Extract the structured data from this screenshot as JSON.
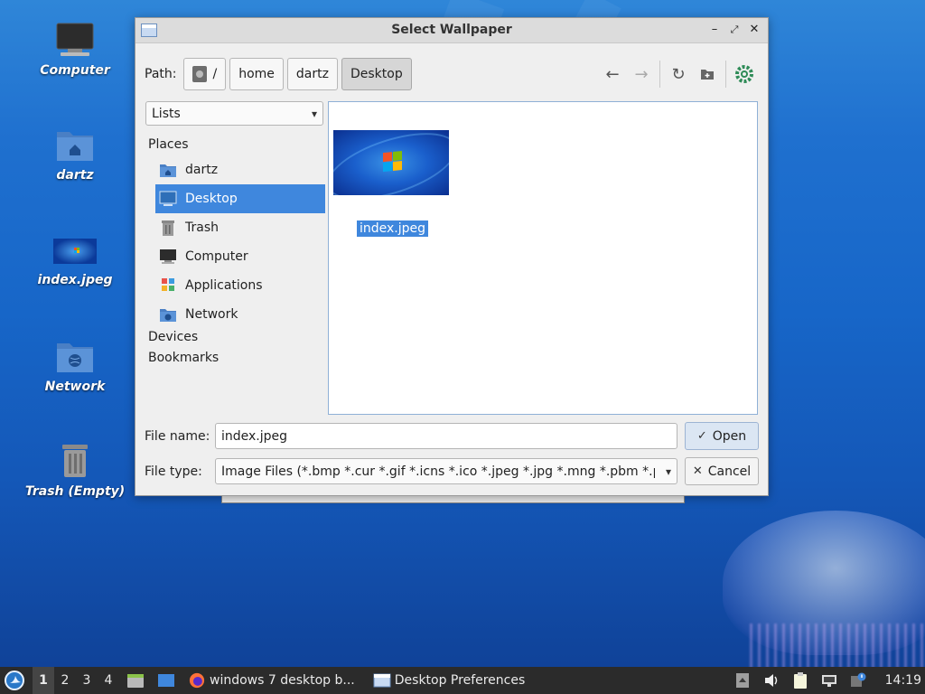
{
  "desktop": {
    "icons": [
      {
        "label": "Computer"
      },
      {
        "label": "dartz"
      },
      {
        "label": "index.jpeg"
      },
      {
        "label": "Network"
      },
      {
        "label": "Trash (Empty)"
      }
    ]
  },
  "dialog": {
    "title": "Select Wallpaper",
    "path_label": "Path:",
    "crumbs": [
      "/",
      "home",
      "dartz",
      "Desktop"
    ],
    "view_mode": "Lists",
    "sections": {
      "places": "Places",
      "devices": "Devices",
      "bookmarks": "Bookmarks"
    },
    "places": [
      {
        "label": "dartz",
        "icon": "home-folder-icon"
      },
      {
        "label": "Desktop",
        "icon": "desktop-icon"
      },
      {
        "label": "Trash",
        "icon": "trash-icon"
      },
      {
        "label": "Computer",
        "icon": "computer-icon"
      },
      {
        "label": "Applications",
        "icon": "applications-icon"
      },
      {
        "label": "Network",
        "icon": "network-icon"
      }
    ],
    "selected_place": "Desktop",
    "files": [
      {
        "name": "index.jpeg",
        "selected": true
      }
    ],
    "file_name_label": "File name:",
    "file_name_value": "index.jpeg",
    "file_type_label": "File type:",
    "file_type_value": "Image Files (*.bmp *.cur *.gif *.icns *.ico *.jpeg *.jpg *.mng *.pbm *.pgm",
    "open_label": "Open",
    "cancel_label": "Cancel"
  },
  "taskbar": {
    "workspaces": [
      "1",
      "2",
      "3",
      "4"
    ],
    "active_workspace": "1",
    "tasks": [
      {
        "label": "windows 7 desktop b...",
        "icon": "firefox-icon"
      },
      {
        "label": "Desktop Preferences",
        "icon": "window-icon"
      }
    ],
    "clock": "14:19"
  },
  "colors": {
    "selection": "#3f87dd",
    "taskbar": "#2b2b2b",
    "dialog_bg": "#efefef"
  }
}
